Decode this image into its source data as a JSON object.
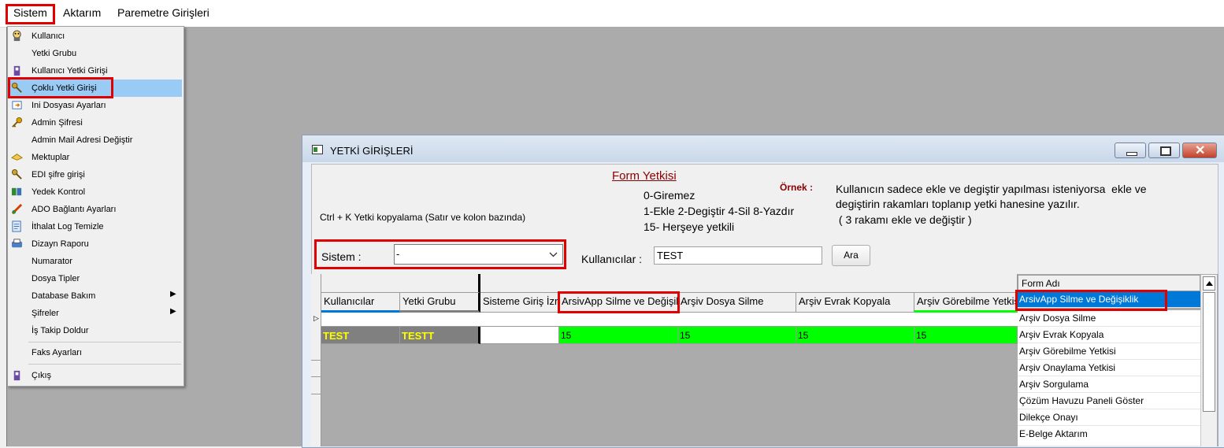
{
  "menubar": {
    "items": [
      "Sistem",
      "Aktarım",
      "Paremetre Girişleri"
    ]
  },
  "sistem_menu": {
    "items": [
      {
        "label": "Kullanıcı",
        "icon": "user-icon"
      },
      {
        "label": "Yetki Grubu",
        "icon": ""
      },
      {
        "label": "Kullanıcı Yetki Girişi",
        "icon": "user-key-icon"
      },
      {
        "label": "Çoklu Yetki Girişi",
        "icon": "multi-key-icon"
      },
      {
        "label": "Ini Dosyası  Ayarları",
        "icon": "ini-file-icon"
      },
      {
        "label": "Admin Şifresi",
        "icon": "key-icon"
      },
      {
        "label": "Admin Mail Adresi Değiştir",
        "icon": ""
      },
      {
        "label": "Mektuplar",
        "icon": "letter-icon"
      },
      {
        "label": "EDI şifre girişi",
        "icon": "edi-key-icon"
      },
      {
        "label": "Yedek Kontrol",
        "icon": "backup-icon"
      },
      {
        "label": "ADO Bağlantı Ayarları",
        "icon": "connection-icon"
      },
      {
        "label": "İthalat Log Temizle",
        "icon": "clean-log-icon"
      },
      {
        "label": "Dizayn Raporu",
        "icon": "report-icon"
      },
      {
        "label": "Numarator",
        "icon": ""
      },
      {
        "label": "Dosya Tipler",
        "icon": ""
      },
      {
        "label": "Database Bakım",
        "icon": "",
        "submenu": true
      },
      {
        "label": "Şifreler",
        "icon": "",
        "submenu": true
      },
      {
        "label": "İş Takip Doldur",
        "icon": ""
      },
      {
        "label": "Faks Ayarları",
        "icon": ""
      },
      {
        "label": "Çıkış",
        "icon": "exit-icon"
      }
    ]
  },
  "window": {
    "title": "YETKİ GİRİŞLERİ",
    "form_yetkisi": "Form Yetkisi",
    "ornek_label": "Örnek :",
    "legend": [
      "0-Giremez",
      "1-Ekle  2-Degiştir  4-Sil  8-Yazdır",
      "15- Herşeye yetkili"
    ],
    "example_text": [
      "Kullanıcın sadece ekle ve degiştir yapılması isteniyorsa  ekle ve",
      "degiştirin rakamları toplanıp yetki hanesine yazılır.",
      " ( 3 rakamı ekle ve değiştir )"
    ],
    "copy_hint": "Ctrl + K Yetki kopyalama (Satır ve kolon bazında)",
    "sistem_label": "Sistem :",
    "sistem_value": "-",
    "kullanicilar_label": "Kullanıcılar :",
    "kullanicilar_value": "TEST",
    "ara_button": "Ara"
  },
  "grid": {
    "columns": [
      "Kullanıcılar",
      "Yetki Grubu",
      "Sisteme Giriş İzni",
      "ArsivApp Silme ve Değişiklik",
      "Arşiv Dosya Silme",
      "Arşiv Evrak Kopyala",
      "Arşiv Görebilme Yetkisi"
    ],
    "rows": [
      {
        "kullanici": "TEST",
        "yetki_grubu": "TESTT",
        "sisteme_giris": "",
        "values": [
          "15",
          "15",
          "15",
          "15"
        ]
      }
    ],
    "colors": {
      "green": "#00ff00",
      "gray": "#808080",
      "yellow": "#ffff00"
    }
  },
  "form_list": {
    "header": "Form Adı",
    "items": [
      "ArsivApp Silme ve Değişiklik",
      "Arşiv Dosya Silme",
      "Arşiv Evrak Kopyala",
      "Arşiv Görebilme Yetkisi",
      "Arşiv Onaylama Yetkisi",
      "Arşiv Sorgulama",
      "Çözüm Havuzu Paneli Göster",
      "Dilekçe Onayı",
      "E-Belge Aktarım"
    ],
    "selected": 0
  },
  "colors": {
    "highlight_red": "#e00000",
    "selection_blue": "#0078d7",
    "menu_highlight": "#99cbf5"
  }
}
